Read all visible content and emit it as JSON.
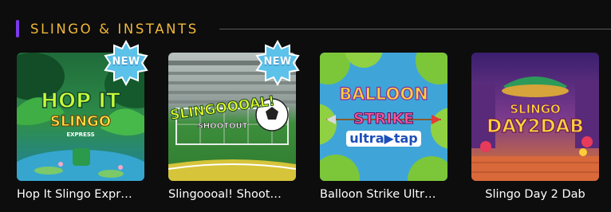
{
  "section": {
    "title": "SLINGO & INSTANTS",
    "accent_color": "#7c3aed",
    "title_color": "#f1b73a"
  },
  "badge_label": "NEW",
  "games": [
    {
      "label": "Hop It Slingo Expr…",
      "badge": true,
      "art": {
        "line1": "HOP IT",
        "line2": "SLINGO",
        "line3": "EXPRESS"
      }
    },
    {
      "label": "Slingoooal! Shoot…",
      "badge": true,
      "art": {
        "line1": "SLINGOOOAL!",
        "line2": "SHOOTOUT"
      }
    },
    {
      "label": "Balloon Strike Ultr…",
      "badge": false,
      "art": {
        "line1": "BALLOON",
        "line2": "STRIKE",
        "line3": "ultra",
        "line4": "tap"
      }
    },
    {
      "label": "Slingo Day 2 Dab",
      "badge": false,
      "art": {
        "line1": "SLINGO",
        "line2": "DAY2DAB"
      }
    }
  ]
}
